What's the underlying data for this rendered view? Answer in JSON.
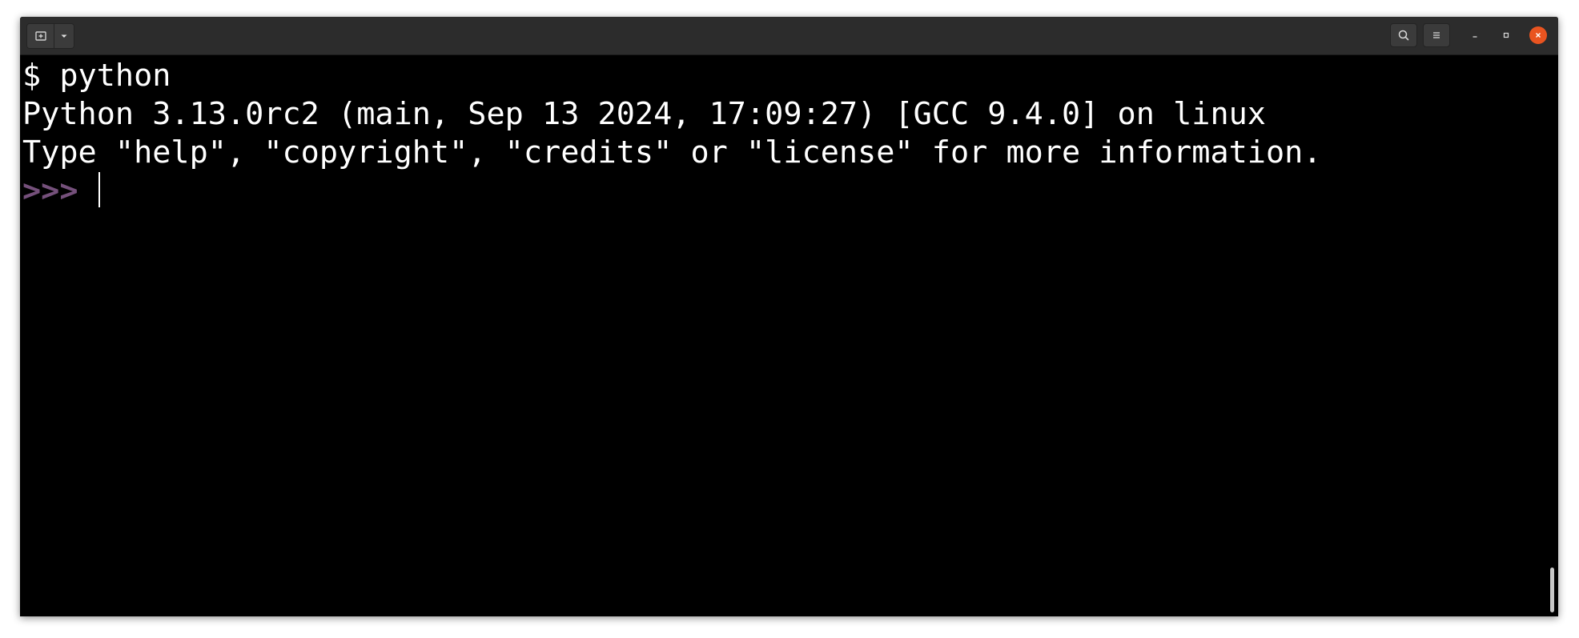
{
  "window": {
    "accent_color": "#e95420",
    "background": "#000000",
    "prompt_color": "#75507b"
  },
  "headerbar": {
    "new_tab_icon": "new-tab-icon",
    "tab_menu_icon": "chevron-down-icon",
    "search_icon": "search-icon",
    "menu_icon": "hamburger-menu-icon",
    "minimize_icon": "minimize-icon",
    "maximize_icon": "maximize-icon",
    "close_icon": "close-icon"
  },
  "terminal": {
    "lines": [
      "$ python",
      "Python 3.13.0rc2 (main, Sep 13 2024, 17:09:27) [GCC 9.4.0] on linux",
      "Type \"help\", \"copyright\", \"credits\" or \"license\" for more information."
    ],
    "prompt": ">>> "
  }
}
